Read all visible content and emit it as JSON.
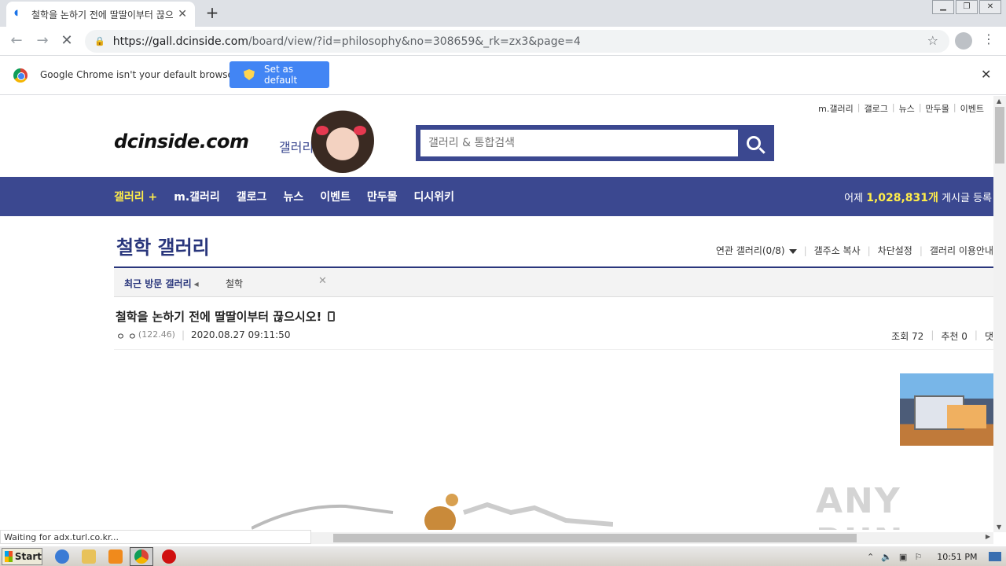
{
  "browser": {
    "tab_title": "철학을 논하기 전에 딸딸이부터 끊으",
    "url_domain": "https://gall.dcinside.com",
    "url_path": "/board/view/?id=philosophy&no=308659&_rk=zx3&page=4",
    "infobar_text": "Google Chrome isn't your default browser",
    "set_default_label": "Set as default",
    "status_text": "Waiting for adx.turl.co.kr..."
  },
  "site": {
    "top_links": [
      "m.갤러리",
      "갤로그",
      "뉴스",
      "만두몰",
      "이벤트"
    ],
    "logo_text": "dcinside.com",
    "logo_sub": "갤러리",
    "search_placeholder": "갤러리 & 통합검색",
    "nav": [
      "갤러리 +",
      "m.갤러리",
      "갤로그",
      "뉴스",
      "이벤트",
      "만두몰",
      "디시위키"
    ],
    "stat_prefix": "어제",
    "stat_count": "1,028,831개",
    "stat_suffix": "게시글 등록"
  },
  "gallery": {
    "title": "철학 갤러리",
    "tools": [
      "연관 갤러리(0/8)",
      "갤주소 복사",
      "차단설정",
      "갤러리 이용안내"
    ],
    "recent_label": "최근 방문 갤러리",
    "recent_item": "철학"
  },
  "post": {
    "title": "철학을 논하기 전에 딸딸이부터 끊으시오!",
    "author": "ㅇ ㅇ",
    "ip": "(122.46)",
    "date": "2020.08.27 09:11:50",
    "views": "조회 72",
    "recommend": "추천 0",
    "cut": "댓"
  },
  "watermark": "ANY RUN",
  "taskbar": {
    "start_label": "Start",
    "clock": "10:51 PM"
  }
}
